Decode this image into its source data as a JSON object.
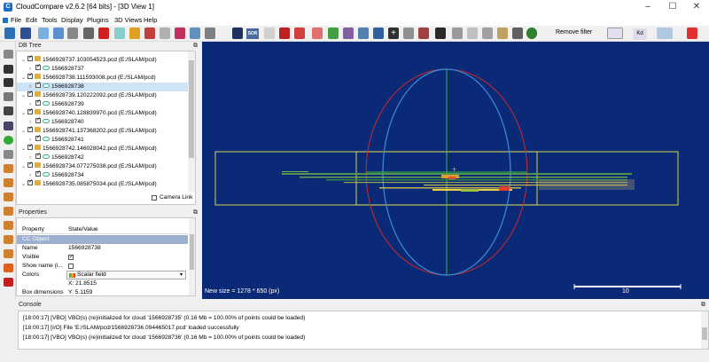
{
  "window": {
    "title": "CloudCompare v2.6.2 [64 bits] - [3D View 1]",
    "min": "–",
    "max": "☐",
    "close": "✕"
  },
  "menu": [
    "File",
    "Edit",
    "Tools",
    "Display",
    "Plugins",
    "3D Views",
    "Help"
  ],
  "toolbar": {
    "sor_label": "SOR",
    "remove_filter": "Remove filter",
    "kd_label": "Kd",
    "icons": [
      "open-icon",
      "save-icon",
      "sample-icon",
      "clone-icon",
      "merge-icon",
      "segment-icon",
      "translate-icon",
      "delete-icon",
      "cloud-icon",
      "color-icon",
      "normal-icon",
      "octree-icon",
      "distance-icon",
      "noise-icon",
      "plane-icon",
      "chessboard-icon",
      "filter-icon",
      "crosshair-icon",
      "cut-icon",
      "camera-icon",
      "histogram-icon",
      "statistics-icon",
      "mesh-icon",
      "pick-icon",
      "plus-icon",
      "minus-icon",
      "link-icon",
      "fit-icon",
      "shield-icon",
      "pointcloud-icon",
      "sphere-icon",
      "grid-icon",
      "view-icon",
      "globe-icon"
    ]
  },
  "db_tree": {
    "title": "DB Tree",
    "items": [
      {
        "label": "1566928737.103054523.pcd (E:/SLAM/pcd)",
        "kind": "folder",
        "level": 0,
        "selected": false
      },
      {
        "label": "1566928737",
        "kind": "cloud",
        "level": 1,
        "selected": false
      },
      {
        "label": "1566928738.111593008.pcd (E:/SLAM/pcd)",
        "kind": "folder",
        "level": 0,
        "selected": false
      },
      {
        "label": "1566928738",
        "kind": "cloud",
        "level": 1,
        "selected": true
      },
      {
        "label": "1566928739.120222092.pcd (E:/SLAM/pcd)",
        "kind": "folder",
        "level": 0,
        "selected": false
      },
      {
        "label": "1566928739",
        "kind": "cloud",
        "level": 1,
        "selected": false
      },
      {
        "label": "1566928740.128839970.pcd (E:/SLAM/pcd)",
        "kind": "folder",
        "level": 0,
        "selected": false
      },
      {
        "label": "1566928740",
        "kind": "cloud",
        "level": 1,
        "selected": false
      },
      {
        "label": "1566928741.137368202.pcd (E:/SLAM/pcd)",
        "kind": "folder",
        "level": 0,
        "selected": false
      },
      {
        "label": "1566928741",
        "kind": "cloud",
        "level": 1,
        "selected": false
      },
      {
        "label": "1566928742.146028042.pcd (E:/SLAM/pcd)",
        "kind": "folder",
        "level": 0,
        "selected": false
      },
      {
        "label": "1566928742",
        "kind": "cloud",
        "level": 1,
        "selected": false
      },
      {
        "label": "1566928734.077275038.pcd (E:/SLAM/pcd)",
        "kind": "folder",
        "level": 0,
        "selected": false
      },
      {
        "label": "1566928734",
        "kind": "cloud",
        "level": 1,
        "selected": false
      },
      {
        "label": "1566928735.085875034.pcd (E:/SLAM/pcd)",
        "kind": "folder",
        "level": 0,
        "selected": false
      }
    ],
    "camera_link": "Camera Link"
  },
  "properties": {
    "title": "Properties",
    "col_property": "Property",
    "col_value": "State/Value",
    "section": "CC Object",
    "rows": [
      {
        "key": "Name",
        "value": "1566928738"
      },
      {
        "key": "Visible",
        "value": ""
      },
      {
        "key": "Show name (i...",
        "value": ""
      },
      {
        "key": "Colors",
        "value": "Scalar field"
      },
      {
        "key": "",
        "value": "X: 21.8515"
      },
      {
        "key": "Box dimensions",
        "value": "Y: 5.1159"
      }
    ]
  },
  "view3d": {
    "status": "New size = 1278 * 650 (px)",
    "scale_label": "10"
  },
  "console": {
    "title": "Console",
    "lines": [
      "[18:00:17] [VBO] VBO(s) (re)initialized for cloud '1566928735' (0.16 Mb = 100.00% of points could be loaded)",
      "[18:00:17] [I/O] File 'E:/SLAM/pcd/1566928736.094465017.pcd' loaded successfully",
      "[18:00:17] [VBO] VBO(s) (re)initialized for cloud '1566928736' (0.16 Mb = 100.00% of points could be loaded)"
    ]
  },
  "colors": {
    "view_bg": "#0a2a78",
    "bbox": "#e6e64a",
    "ring_red": "#d02828",
    "ring_blue": "#3c8cdc",
    "axis_green": "#3cbc3c"
  }
}
